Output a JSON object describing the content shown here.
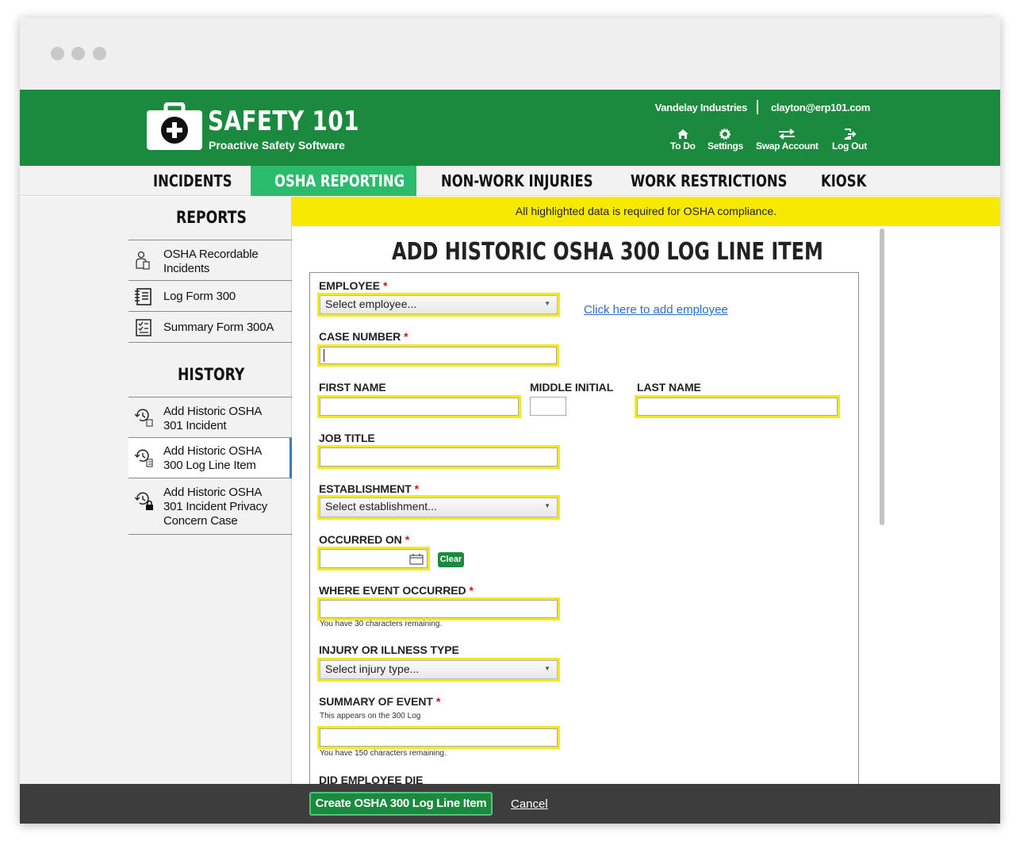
{
  "brand": {
    "title": "SAFETY 101",
    "subtitle": "Proactive Safety Software",
    "green": "#1b8a3f",
    "active_tab": "#2bbb6c",
    "highlight": "#f2ea1b"
  },
  "header": {
    "company": "Vandelay Industries",
    "email": "clayton@erp101.com",
    "links": [
      {
        "label": "To Do",
        "icon": "home-icon"
      },
      {
        "label": "Settings",
        "icon": "gear-icon"
      },
      {
        "label": "Swap Account",
        "icon": "swap-icon"
      },
      {
        "label": "Log Out",
        "icon": "logout-icon"
      }
    ]
  },
  "nav": {
    "tabs": [
      {
        "label": "INCIDENTS"
      },
      {
        "label": "OSHA REPORTING",
        "active": true
      },
      {
        "label": "NON-WORK INJURIES"
      },
      {
        "label": "WORK RESTRICTIONS"
      },
      {
        "label": "KIOSK"
      }
    ]
  },
  "sidebar": {
    "reports_heading": "REPORTS",
    "reports": [
      {
        "line1": "OSHA Recordable",
        "line2": "Incidents",
        "icon": "person-clipboard-icon"
      },
      {
        "line1": "Log Form 300",
        "icon": "log-list-icon"
      },
      {
        "line1": "Summary Form 300A",
        "icon": "checklist-icon"
      }
    ],
    "history_heading": "HISTORY",
    "history": [
      {
        "line1": "Add Historic OSHA",
        "line2": "301 Incident",
        "icon": "history-doc-icon"
      },
      {
        "line1": "Add Historic OSHA",
        "line2": "300 Log Line Item",
        "icon": "history-list-icon",
        "active": true
      },
      {
        "line1": "Add Historic OSHA",
        "line2": "301 Incident Privacy",
        "line3": "Concern Case",
        "icon": "history-lock-icon"
      }
    ]
  },
  "banner": "All highlighted data is required for OSHA compliance.",
  "page_title": "ADD HISTORIC OSHA 300 LOG LINE ITEM",
  "form": {
    "required_marker": "*",
    "employee": {
      "label": "EMPLOYEE",
      "placeholder": "Select employee...",
      "add_link": "Click here to add employee"
    },
    "case_number": {
      "label": "CASE NUMBER",
      "value": ""
    },
    "first_name": {
      "label": "FIRST NAME",
      "value": ""
    },
    "middle_initial": {
      "label": "MIDDLE INITIAL",
      "value": ""
    },
    "last_name": {
      "label": "LAST NAME",
      "value": ""
    },
    "job_title": {
      "label": "JOB TITLE",
      "value": ""
    },
    "establishment": {
      "label": "ESTABLISHMENT",
      "placeholder": "Select establishment..."
    },
    "occurred_on": {
      "label": "OCCURRED ON",
      "value": "",
      "clear_label": "Clear"
    },
    "where_event": {
      "label": "WHERE EVENT OCCURRED",
      "note": "You have 30 characters remaining."
    },
    "injury_type": {
      "label": "INJURY OR ILLNESS TYPE",
      "placeholder": "Select injury type..."
    },
    "summary": {
      "label": "SUMMARY OF EVENT",
      "hint": "This appears on the 300 Log",
      "note": "You have 150 characters remaining."
    },
    "did_die": {
      "label": "DID EMPLOYEE DIE"
    }
  },
  "footer": {
    "create_label": "Create OSHA 300 Log Line Item",
    "cancel_label": "Cancel"
  }
}
